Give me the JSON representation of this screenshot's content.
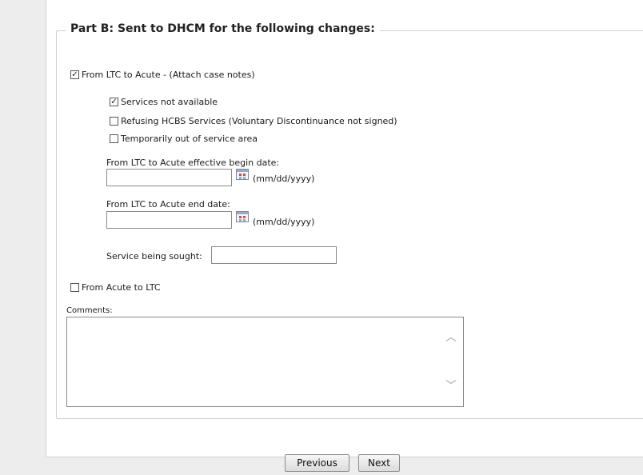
{
  "part_b": {
    "title": "Part B: Sent to DHCM for the following changes:",
    "ltc_to_acute": {
      "label": "From LTC to Acute - (Attach case notes)",
      "checked": true
    },
    "reasons": [
      {
        "label": "Services not available",
        "checked": true
      },
      {
        "label": "Refusing HCBS Services (Voluntary Discontinuance not signed)",
        "checked": false
      },
      {
        "label": "Temporarily out of service area",
        "checked": false
      }
    ],
    "begin_date": {
      "label": "From LTC to Acute effective begin date:",
      "value": "",
      "format": "(mm/dd/yyyy)"
    },
    "end_date": {
      "label": "From LTC to Acute end date:",
      "value": "",
      "format": "(mm/dd/yyyy)"
    },
    "service_sought": {
      "label": "Service being sought:",
      "value": ""
    },
    "acute_to_ltc": {
      "label": "From Acute to LTC",
      "checked": false
    },
    "comments": {
      "label": "Comments:",
      "value": ""
    }
  },
  "nav": {
    "previous": "Previous",
    "next": "Next"
  },
  "icons": {
    "checkmark": "check-icon",
    "calendar": "calendar-icon",
    "scroll_up": "scroll-up-arrow-icon",
    "scroll_down": "scroll-down-arrow-icon"
  }
}
